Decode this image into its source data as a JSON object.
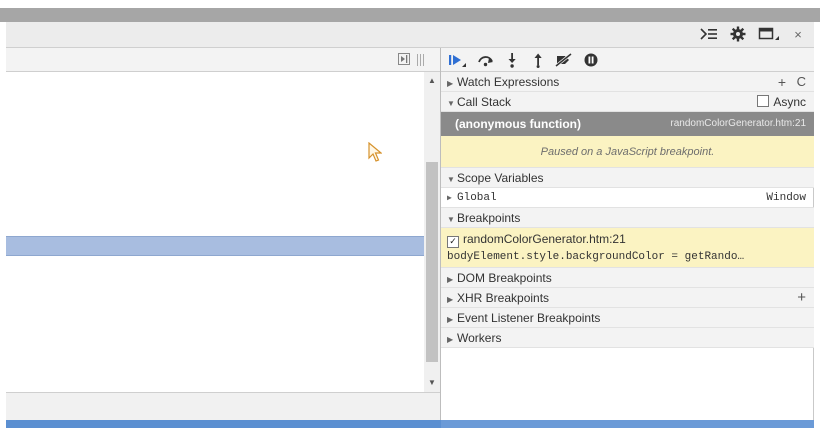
{
  "titlebar": {
    "icons": [
      "console-drawer-icon",
      "gear-icon",
      "dock-icon",
      "close-icon"
    ],
    "close_glyph": "×"
  },
  "debugger_toolbar": {
    "icons": [
      "resume-icon",
      "step-over-icon",
      "step-into-icon",
      "step-out-icon",
      "deactivate-breakpoints-icon",
      "pause-on-exceptions-icon"
    ]
  },
  "sections": {
    "watch": {
      "label": "Watch Expressions",
      "add": "+",
      "refresh": "C"
    },
    "call_stack": {
      "label": "Call Stack",
      "async_label": "Async",
      "frame": {
        "name": "(anonymous function)",
        "location": "randomColorGenerator.htm:21"
      },
      "paused_message": "Paused on a JavaScript breakpoint."
    },
    "scope": {
      "label": "Scope Variables",
      "global": {
        "name": "Global",
        "value": "Window"
      }
    },
    "breakpoints": {
      "label": "Breakpoints",
      "entry": {
        "location": "randomColorGenerator.htm:21",
        "code": "bodyElement.style.backgroundColor = getRando…"
      }
    },
    "dom_breakpoints": {
      "label": "DOM Breakpoints"
    },
    "xhr_breakpoints": {
      "label": "XHR Breakpoints",
      "add": "+"
    },
    "event_listener_breakpoints": {
      "label": "Event Listener Breakpoints"
    },
    "workers": {
      "label": "Workers"
    }
  },
  "colors": {
    "highlight_line": "#a8bde0",
    "paused_bg": "#fbf3c2",
    "frame_bg": "#8a8a8a",
    "accent_blue": "#2f6fd3"
  }
}
